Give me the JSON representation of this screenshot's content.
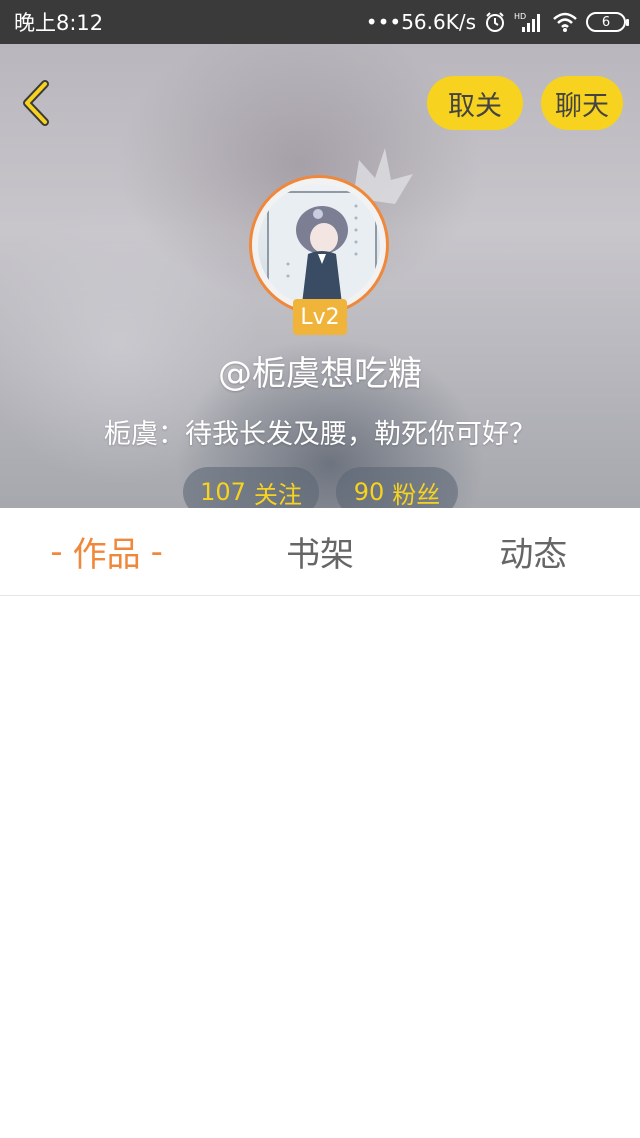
{
  "status_bar": {
    "time": "晚上8:12",
    "network_speed": "•••56.6K/s",
    "icons": [
      "alarm-icon",
      "hd-signal-icon",
      "wifi-icon",
      "battery-icon"
    ],
    "battery_level": "6"
  },
  "header": {
    "back_icon": "chevron-left-icon",
    "unfollow_label": "取关",
    "chat_label": "聊天",
    "level": "Lv2",
    "username": "@栀虞想吃糖",
    "bio": "栀虞：待我长发及腰，勒死你可好？",
    "following_count": "107",
    "following_label": "关注",
    "fans_count": "90",
    "fans_label": "粉丝"
  },
  "tabs": {
    "works": "作品",
    "bookshelf": "书架",
    "activity": "动态",
    "active_dash": "-"
  },
  "colors": {
    "accent_yellow": "#f7d21e",
    "accent_orange": "#f0883c",
    "level_badge": "#f0b43a"
  }
}
